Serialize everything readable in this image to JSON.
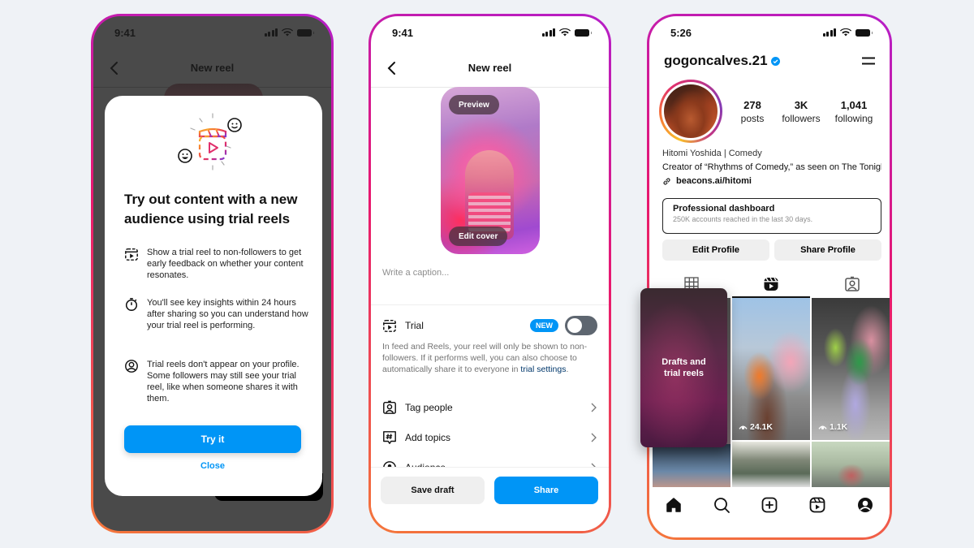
{
  "colors": {
    "background": "#eff2f6",
    "accent_blue": "#0095f6",
    "link_dark_blue": "#00376b",
    "frame_gradient": [
      "#b51ec8",
      "#e8186e",
      "#f4773a"
    ]
  },
  "phone1": {
    "status_time": "9:41",
    "header_title": "New reel",
    "back_icon": "chevron-left-icon",
    "sheet": {
      "illustration": "trial-reels-illustration",
      "title": "Try out content with a new audience using trial reels",
      "features": [
        {
          "icon": "reels-dashed-icon",
          "text": "Show a trial reel to non-followers to get early feedback on whether your content resonates."
        },
        {
          "icon": "stopwatch-icon",
          "text": "You'll see key insights within 24 hours after sharing so you can understand how your trial reel is performing."
        },
        {
          "icon": "profile-circle-icon",
          "text": "Trial reels don't appear on your profile. Some followers may still see your trial reel, like when someone shares it with them."
        }
      ],
      "primary_button": "Try it",
      "close_link": "Close"
    }
  },
  "phone2": {
    "status_time": "9:41",
    "header_title": "New reel",
    "preview_label": "Preview",
    "edit_cover_label": "Edit cover",
    "caption_placeholder": "Write a caption...",
    "caption_value": "",
    "trial": {
      "label": "Trial",
      "badge": "NEW",
      "toggle_on": false,
      "description": "In feed and Reels, your reel will only be shown to non-followers. If it performs well, you can also choose to automatically share it to everyone in ",
      "link_text": "trial settings",
      "trailing": "."
    },
    "menu_items": [
      {
        "icon": "tag-people-icon",
        "label": "Tag people"
      },
      {
        "icon": "hashtag-icon",
        "label": "Add topics"
      },
      {
        "icon": "audience-icon",
        "label": "Audience"
      }
    ],
    "save_draft_label": "Save draft",
    "share_label": "Share"
  },
  "phone3": {
    "status_time": "5:26",
    "username": "gogoncalves.21",
    "verified": true,
    "stats": [
      {
        "value": "278",
        "label": "posts"
      },
      {
        "value": "3K",
        "label": "followers"
      },
      {
        "value": "1,041",
        "label": "following"
      }
    ],
    "bio_name": "Hitomi Yoshida | Comedy",
    "bio_text": "Creator of “Rhythms of Comedy,” as seen on The Tonight Show",
    "link": "beacons.ai/hitomi",
    "dashboard": {
      "title": "Professional dashboard",
      "subtitle": "250K accounts reached in the last 30 days."
    },
    "edit_profile_label": "Edit Profile",
    "share_profile_label": "Share Profile",
    "tabs": [
      {
        "icon": "grid-icon",
        "active": false
      },
      {
        "icon": "reels-icon",
        "active": true
      },
      {
        "icon": "tagged-icon",
        "active": false
      }
    ],
    "drafts_card_label": "Drafts and trial reels",
    "reels": [
      {
        "views": "24.1K"
      },
      {
        "views": "1.1K"
      }
    ],
    "bottom_nav": [
      "home-icon",
      "search-icon",
      "create-icon",
      "reels-icon",
      "profile-icon"
    ]
  }
}
